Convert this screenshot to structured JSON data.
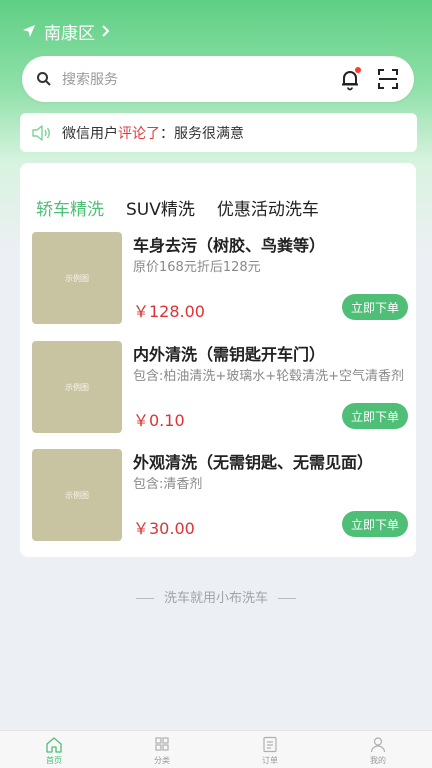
{
  "location": {
    "label": "南康区"
  },
  "search": {
    "placeholder": "搜索服务"
  },
  "notice": {
    "user": "微信用户",
    "action": "评论了",
    "content": "：服务很满意"
  },
  "tabs": [
    {
      "label": "轿车精洗",
      "active": true
    },
    {
      "label": "SUV精洗",
      "active": false
    },
    {
      "label": "优惠活动洗车",
      "active": false
    }
  ],
  "services": [
    {
      "title": "车身去污（树胶、鸟粪等）",
      "desc": "原价168元折后128元",
      "price": "￥128.00",
      "button": "立即下单",
      "thumb_text": "示例图"
    },
    {
      "title": "内外清洗（需钥匙开车门）",
      "desc": "包含:柏油清洗+玻璃水+轮毂清洗+空气清香剂",
      "price": "￥0.10",
      "button": "立即下单",
      "thumb_text": "示例图"
    },
    {
      "title": "外观清洗（无需钥匙、无需见面）",
      "desc": "包含:清香剂",
      "price": "￥30.00",
      "button": "立即下单",
      "thumb_text": "示例图"
    }
  ],
  "footer_note": "洗车就用小布洗车",
  "tabbar": [
    {
      "label": "首页",
      "active": true
    },
    {
      "label": "分类",
      "active": false
    },
    {
      "label": "订单",
      "active": false
    },
    {
      "label": "我的",
      "active": false
    }
  ],
  "colors": {
    "accent": "#4fbf78",
    "price": "#d33333",
    "thumb": "#c8c4a2"
  }
}
